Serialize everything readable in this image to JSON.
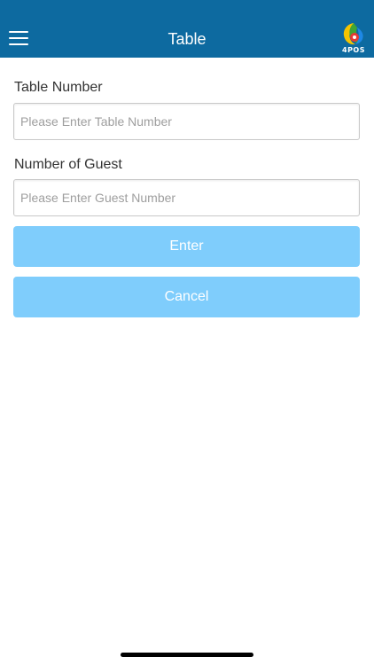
{
  "header": {
    "title": "Table",
    "background_color": "#0d6aa0",
    "logo_text": "4POS",
    "menu_icon": "hamburger-menu-icon"
  },
  "form": {
    "table_number": {
      "label": "Table Number",
      "value": "",
      "placeholder": "Please Enter Table Number"
    },
    "guest_number": {
      "label": "Number of Guest",
      "value": "",
      "placeholder": "Please Enter Guest Number"
    }
  },
  "buttons": {
    "enter_label": "Enter",
    "cancel_label": "Cancel",
    "color": "#7fcdfc"
  }
}
